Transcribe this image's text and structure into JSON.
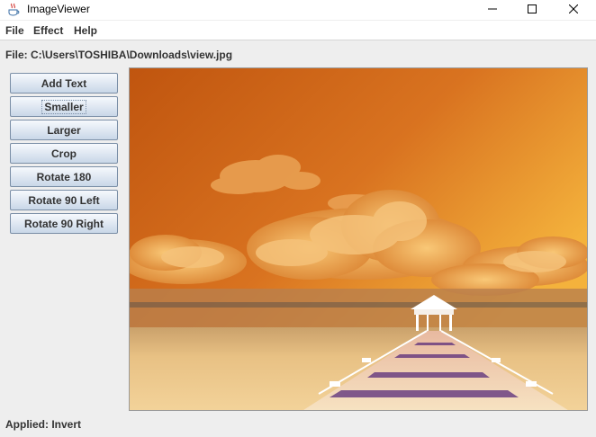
{
  "window": {
    "title": "ImageViewer",
    "icon": "java-cup-icon"
  },
  "menu": {
    "items": [
      "File",
      "Effect",
      "Help"
    ]
  },
  "file_label": "File: C:\\Users\\TOSHIBA\\Downloads\\view.jpg",
  "buttons": [
    {
      "label": "Add Text"
    },
    {
      "label": "Smaller",
      "focused": true
    },
    {
      "label": "Larger"
    },
    {
      "label": "Crop"
    },
    {
      "label": "Rotate 180"
    },
    {
      "label": "Rotate 90 Left"
    },
    {
      "label": "Rotate 90 Right"
    }
  ],
  "status": "Applied: Invert",
  "colors": {
    "sky_top": "#c75a10",
    "sky_mid": "#e0852a",
    "sky_right": "#f5b740",
    "clouds": "#f3b563",
    "water": "#f0c985",
    "pier": "#f6dcb2",
    "pier_shadow": "#6b2f8a"
  }
}
